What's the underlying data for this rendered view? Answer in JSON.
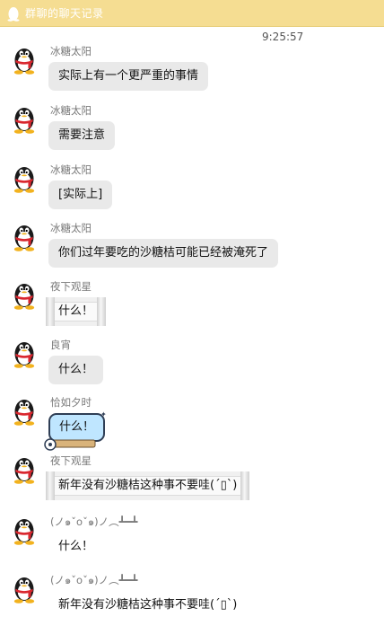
{
  "window": {
    "title": "群聊的聊天记录"
  },
  "timestamp": "9:25:57",
  "messages": [
    {
      "sender": "冰糖太阳",
      "text": "实际上有一个更严重的事情",
      "style": "gray"
    },
    {
      "sender": "冰糖太阳",
      "text": "需要注意",
      "style": "gray"
    },
    {
      "sender": "冰糖太阳",
      "text": "[实际上]",
      "style": "gray"
    },
    {
      "sender": "冰糖太阳",
      "text": "你们过年要吃的沙糖桔可能已经被淹死了",
      "style": "gray"
    },
    {
      "sender": "夜下观星",
      "text": "什么！",
      "style": "frame"
    },
    {
      "sender": "良宵",
      "text": "什么！",
      "style": "gray"
    },
    {
      "sender": "恰如夕时",
      "text": "什么！",
      "style": "cyan"
    },
    {
      "sender": "夜下观星",
      "text": "新年没有沙糖桔这种事不要哇(´▯`)",
      "style": "frame"
    },
    {
      "sender": "(ノ๑ˇoˇ๑)ノ︵┻━┻",
      "text": "什么！",
      "style": "plain"
    },
    {
      "sender": "(ノ๑ˇoˇ๑)ノ︵┻━┻",
      "text": "新年没有沙糖桔这种事不要哇(´▯`)",
      "style": "plain"
    }
  ],
  "colors": {
    "titlebar": "#f5dd92",
    "bubble_gray": "#e9e9e9",
    "bubble_cyan": "#bfe6ff",
    "sender_text": "#7a7a7a"
  },
  "icons": {
    "titlebar": "qq-penguin-icon",
    "avatar": "qq-penguin-avatar-icon"
  }
}
